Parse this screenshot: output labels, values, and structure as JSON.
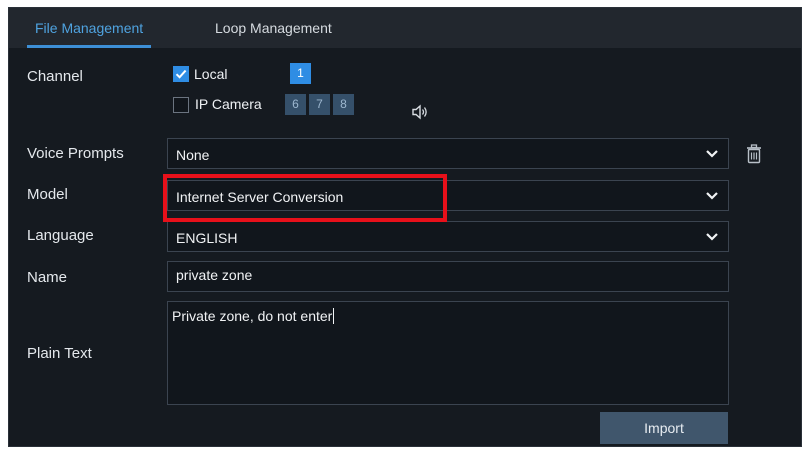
{
  "tabs": [
    {
      "label": "File Management",
      "active": true
    },
    {
      "label": "Loop Management",
      "active": false
    }
  ],
  "channel": {
    "label": "Channel",
    "local": {
      "label": "Local",
      "checked": true,
      "channels": [
        "1"
      ]
    },
    "ip_camera": {
      "label": "IP Camera",
      "checked": false,
      "channels": [
        "6",
        "7",
        "8"
      ]
    },
    "audio_icon": "speaker-icon"
  },
  "voice_prompts": {
    "label": "Voice Prompts",
    "value": "None",
    "delete_icon": "trash-icon"
  },
  "model": {
    "label": "Model",
    "value": "Internet Server Conversion"
  },
  "language": {
    "label": "Language",
    "value": "ENGLISH"
  },
  "name": {
    "label": "Name",
    "value": "private zone"
  },
  "plain_text": {
    "label": "Plain Text",
    "value": "Private zone, do not enter"
  },
  "import_button": {
    "label": "Import"
  },
  "colors": {
    "accent": "#2f8de4",
    "panel_bg": "#151a20",
    "highlight": "#e8101a"
  }
}
